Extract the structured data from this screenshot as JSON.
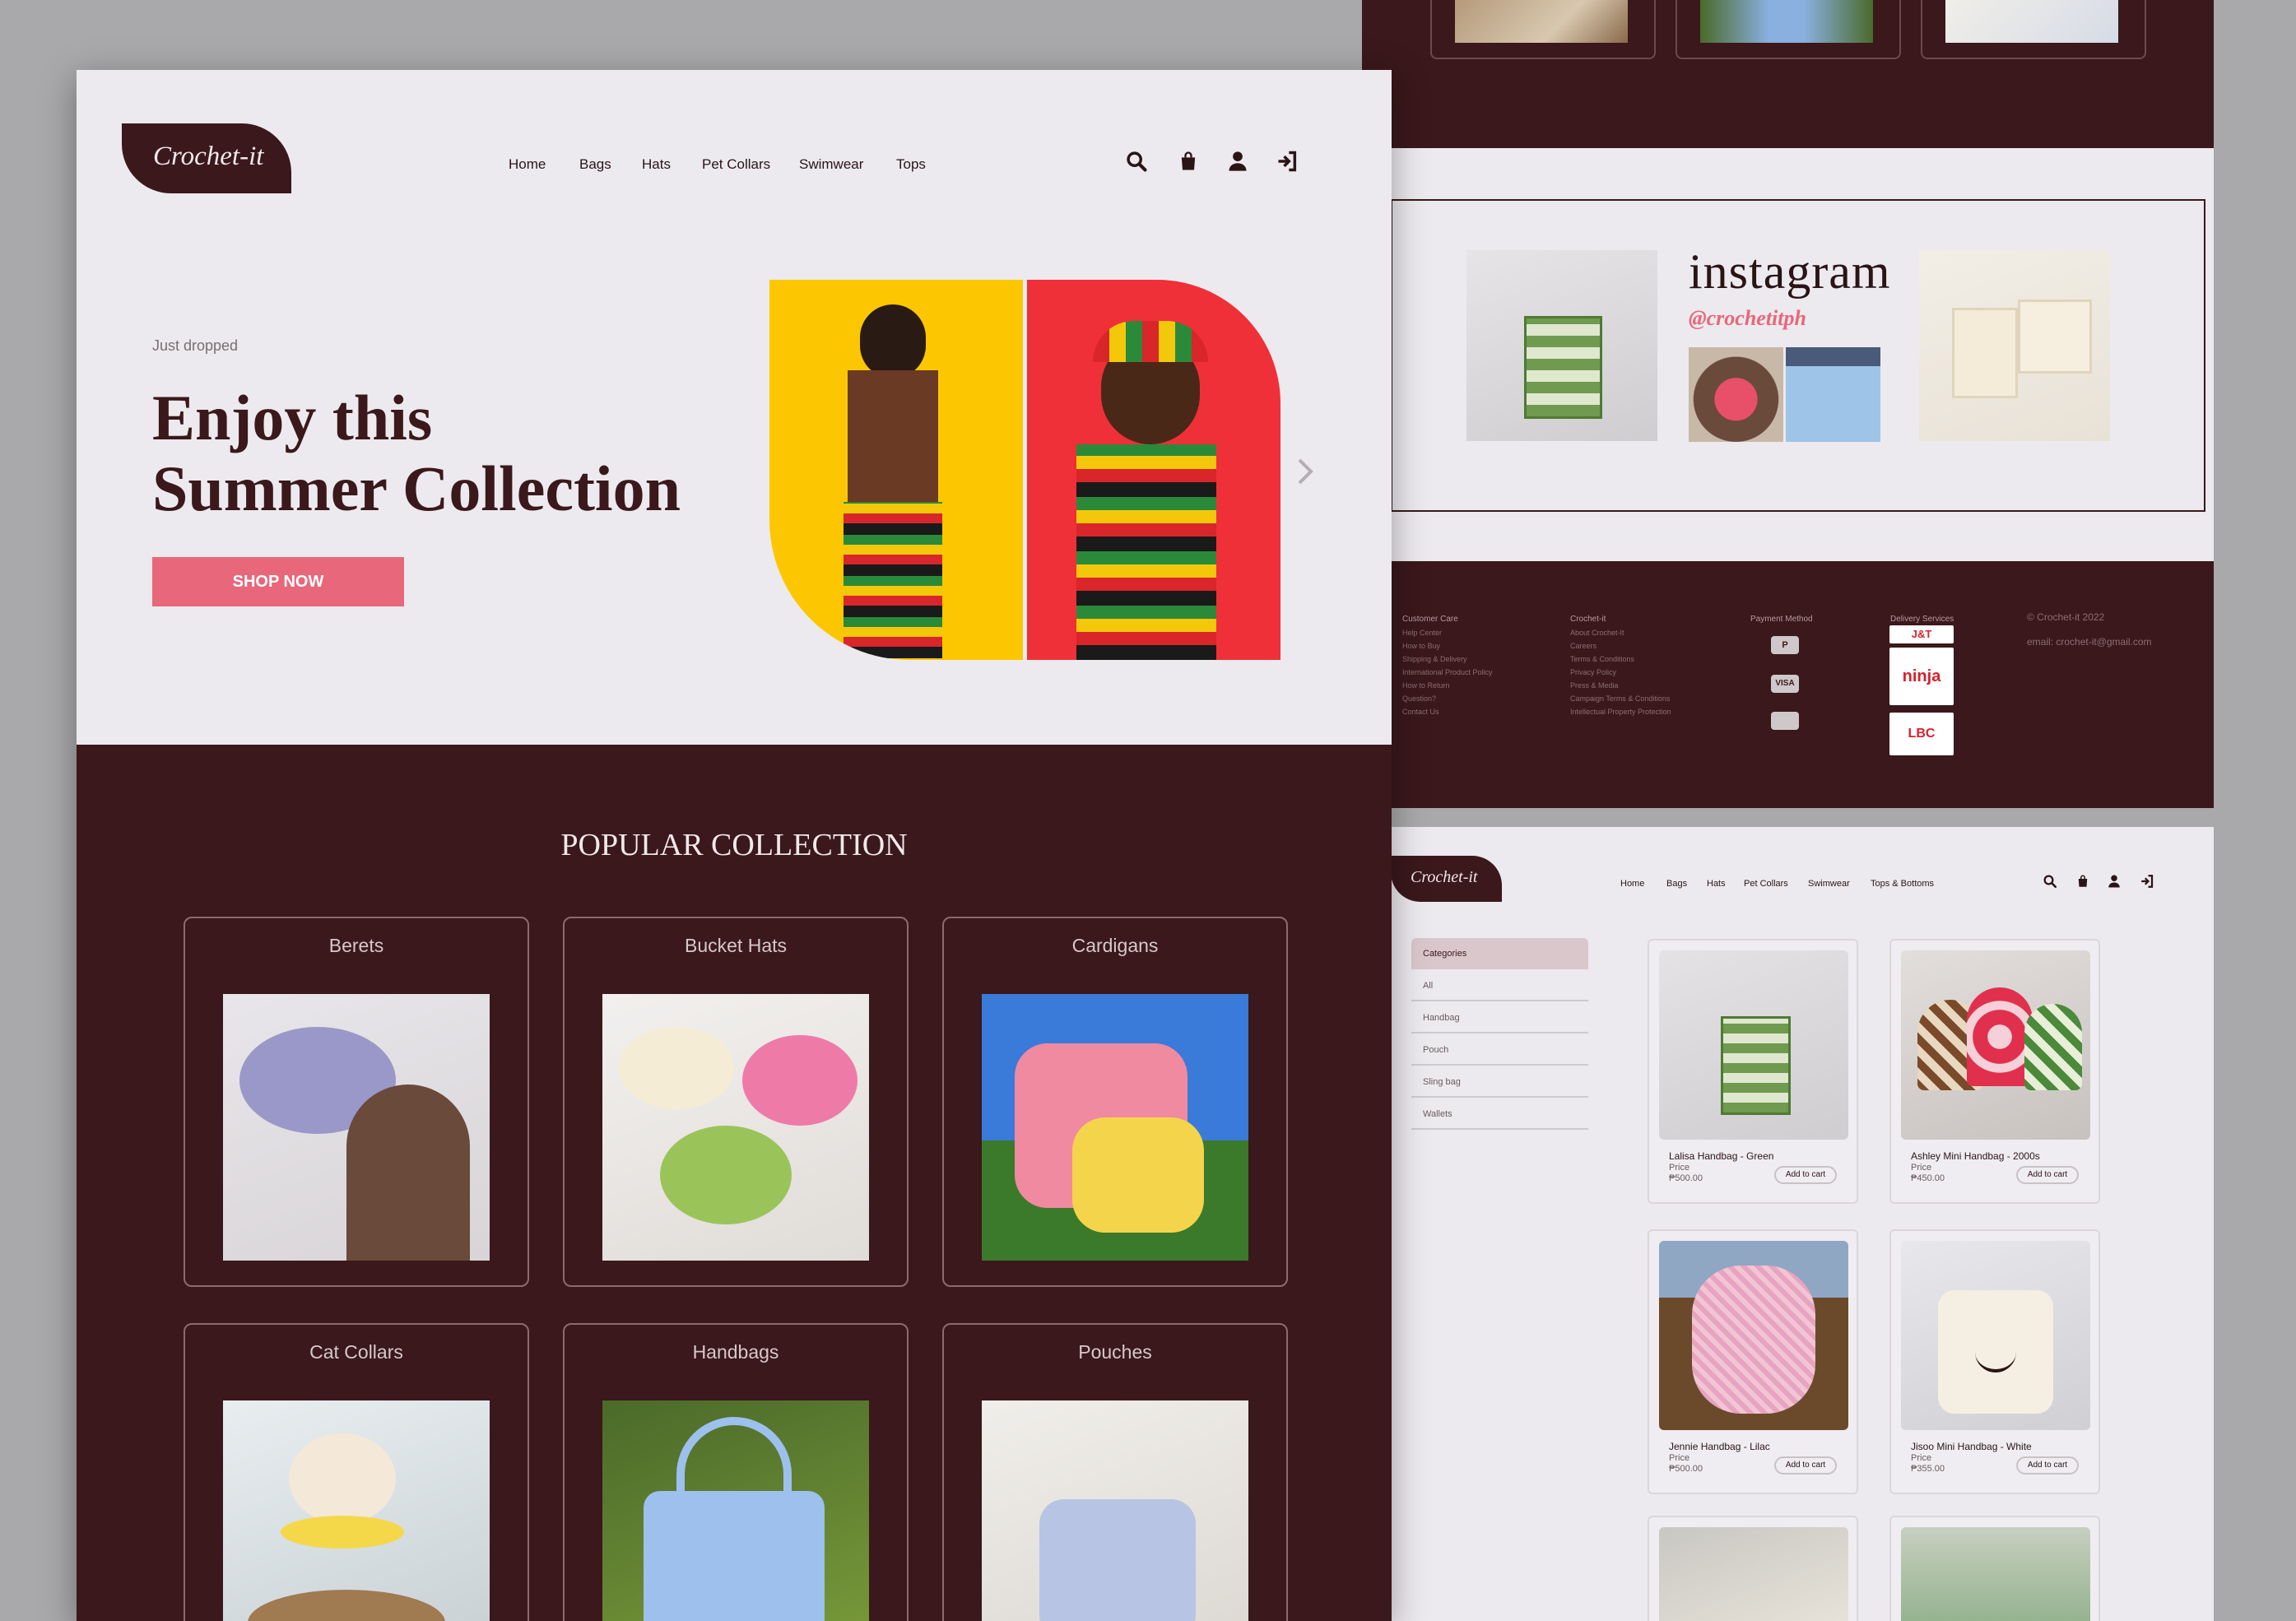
{
  "brand": {
    "logo": "Crochet-it"
  },
  "nav": {
    "items": [
      "Home",
      "Bags",
      "Hats",
      "Pet Collars",
      "Swimwear",
      "Tops"
    ]
  },
  "hero": {
    "eyebrow": "Just dropped",
    "title_line1": "Enjoy this",
    "title_line2": "Summer Collection",
    "cta": "SHOP NOW"
  },
  "popular": {
    "title": "POPULAR COLLECTION",
    "cards": [
      "Berets",
      "Bucket Hats",
      "Cardigans",
      "Cat Collars",
      "Handbags",
      "Pouches"
    ]
  },
  "instagram": {
    "title": "instagram",
    "handle": "@crochetitph"
  },
  "footer": {
    "customer_care": {
      "heading": "Customer Care",
      "links": [
        "Help Center",
        "How to Buy",
        "Shipping & Delivery",
        "International Product Policy",
        "How to Return",
        "Question?",
        "Contact Us"
      ]
    },
    "company": {
      "heading": "Crochet-it",
      "links": [
        "About Crochet-It",
        "Careers",
        "Terms & Conditions",
        "Privacy Policy",
        "Press & Media",
        "Campaign Terms & Conditions",
        "Intellectual Property Protection"
      ]
    },
    "payment": {
      "heading": "Payment Method",
      "methods": [
        "P",
        "VISA",
        ""
      ]
    },
    "delivery": {
      "heading": "Delivery Services",
      "services": [
        "J&T",
        "ninja van",
        "LBC"
      ]
    },
    "copyright": "© Crochet-it 2022",
    "email": "email: crochet-it@gmail.com"
  },
  "shop": {
    "logo": "Crochet-it",
    "nav": [
      "Home",
      "Bags",
      "Hats",
      "Pet Collars",
      "Swimwear",
      "Tops & Bottoms"
    ],
    "categories_heading": "Categories",
    "categories": [
      "All",
      "Handbag",
      "Pouch",
      "Sling bag",
      "Wallets"
    ],
    "price_label": "Price",
    "add_to_cart": "Add to cart",
    "products": [
      {
        "name": "Lalisa Handbag - Green",
        "price": "₱500.00"
      },
      {
        "name": "Ashley Mini Handbag - 2000s",
        "price": "₱450.00"
      },
      {
        "name": "Jennie Handbag - Lilac",
        "price": "₱500.00"
      },
      {
        "name": "Jisoo Mini Handbag - White",
        "price": "₱355.00"
      }
    ]
  },
  "colors": {
    "maroon": "#3a181b",
    "accent_pink": "#e8677a",
    "page_bg": "#eceaee"
  }
}
